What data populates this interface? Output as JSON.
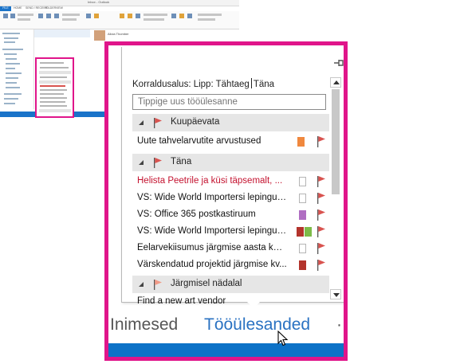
{
  "thumbnail": {
    "title_hint": "Inbox - Outlook",
    "tabs": [
      "FILE",
      "HOME",
      "SEND / RECEIVE",
      "FOLDER",
      "VIEW"
    ],
    "preview_name": "Alicia Thomber"
  },
  "task_peek": {
    "sort_by": "Korraldusalus: Lipp: Tähtaeg",
    "sort_value": "Täna",
    "new_task_placeholder": "Tippige uus tööülesanne",
    "groups": [
      {
        "label": "Kuupäevata",
        "flag_color": "#d9534f",
        "tasks": [
          {
            "text": "Uute tahvelarvutite arvustused",
            "overdue": false,
            "categories": [
              "#f0883e"
            ]
          }
        ]
      },
      {
        "label": "Täna",
        "flag_color": "#d9534f",
        "tasks": [
          {
            "text": "Helista Peetrile ja küsi täpsemalt, ...",
            "overdue": true,
            "categories": []
          },
          {
            "text": "VS: Wide World Importersi lepingud...",
            "overdue": false,
            "categories": []
          },
          {
            "text": "VS: Office 365 postkastiruum",
            "overdue": false,
            "categories": [
              "#b06ec2"
            ]
          },
          {
            "text": "VS: Wide World Importersi lepingud...",
            "overdue": false,
            "categories": [
              "#b3342c",
              "#7dbb48"
            ]
          },
          {
            "text": "Eelarvekiisumus järgmise aasta kohta",
            "overdue": false,
            "categories": []
          },
          {
            "text": "Värskendatud projektid järgmise kv...",
            "overdue": false,
            "categories": [
              "#b3342c"
            ]
          }
        ]
      },
      {
        "label": "Järgmisel nädalal",
        "flag_color": "#f19a87",
        "tasks": []
      }
    ],
    "partial_row": "Find a new art vendor"
  },
  "navigation": {
    "people": "Inimesed",
    "tasks": "Tööülesanded",
    "more": "··"
  },
  "colors": {
    "highlight_frame": "#e0158a",
    "accent_blue": "#2a72c2",
    "status_bar": "#0d72c7",
    "overdue_text": "#c4122f"
  }
}
